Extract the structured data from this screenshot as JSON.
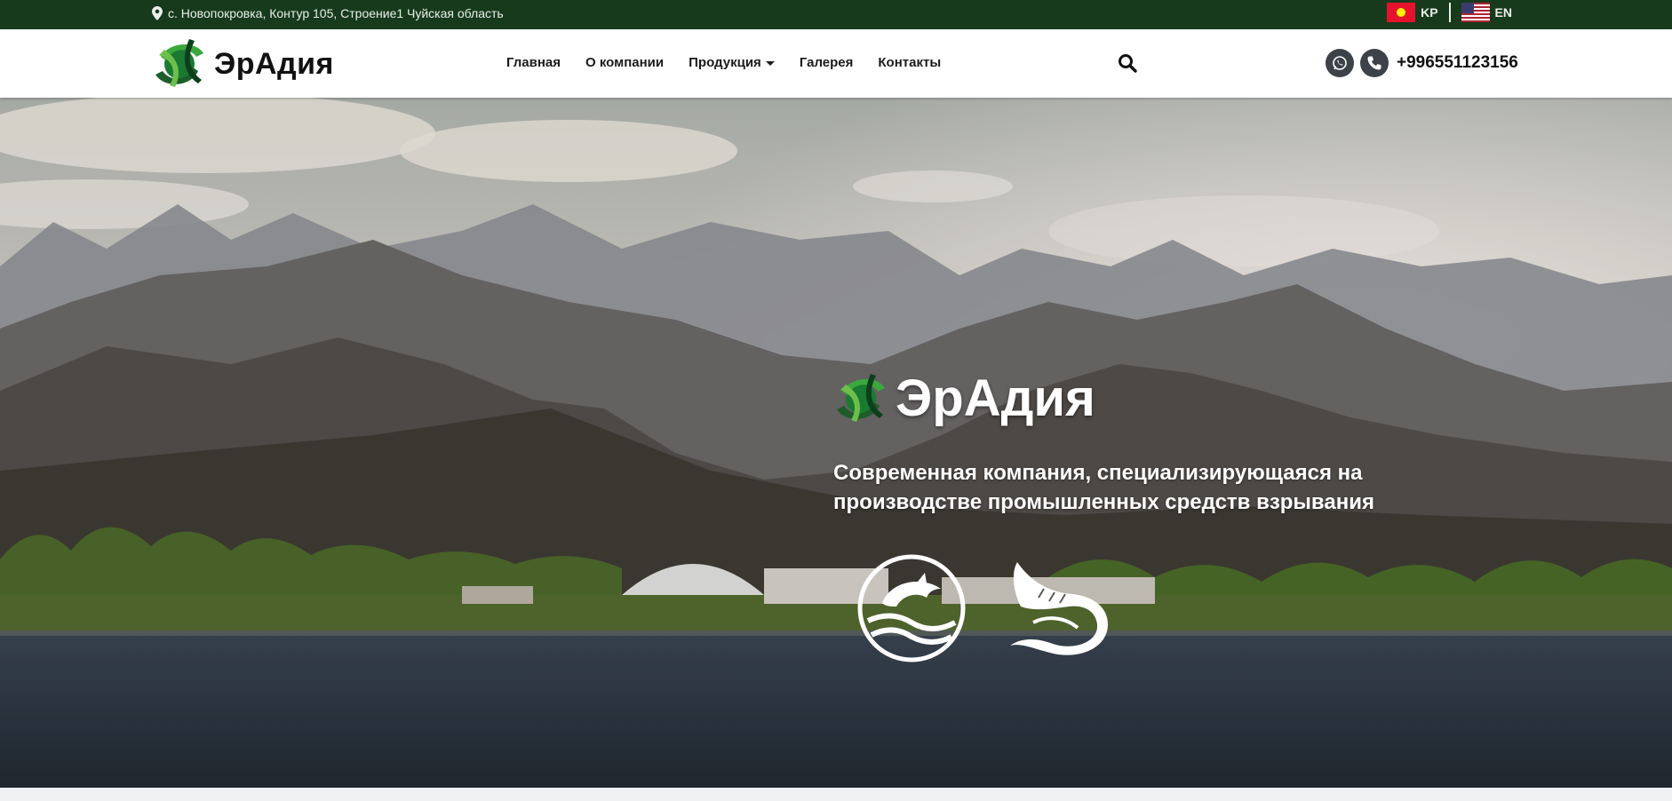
{
  "topbar": {
    "address": "с. Новопокровка, Контур 105, Строение1 Чуйская область",
    "languages": [
      {
        "code": "KP",
        "flag": "kyrgyzstan-flag-icon"
      },
      {
        "code": "EN",
        "flag": "usa-flag-icon"
      }
    ]
  },
  "header": {
    "brand": "ЭрАдия",
    "nav": [
      {
        "label": "Главная"
      },
      {
        "label": "О компании"
      },
      {
        "label": "Продукция",
        "has_dropdown": true
      },
      {
        "label": "Галерея"
      },
      {
        "label": "Контакты"
      }
    ],
    "icons": {
      "search": "search-icon",
      "whatsapp": "whatsapp-icon",
      "phone": "phone-icon"
    },
    "phone": "+996551123156"
  },
  "hero": {
    "title": "ЭрАдия",
    "subtitle": "Современная компания, специализирующаяся на производстве промышленных средств взрывания",
    "badges": [
      "dolphin-logo",
      "stingray-logo"
    ]
  },
  "colors": {
    "topbar_bg": "#173a1d",
    "header_bg": "#ffffff",
    "accent_green": "#2e9e3e",
    "icon_btn": "#3d4249"
  }
}
